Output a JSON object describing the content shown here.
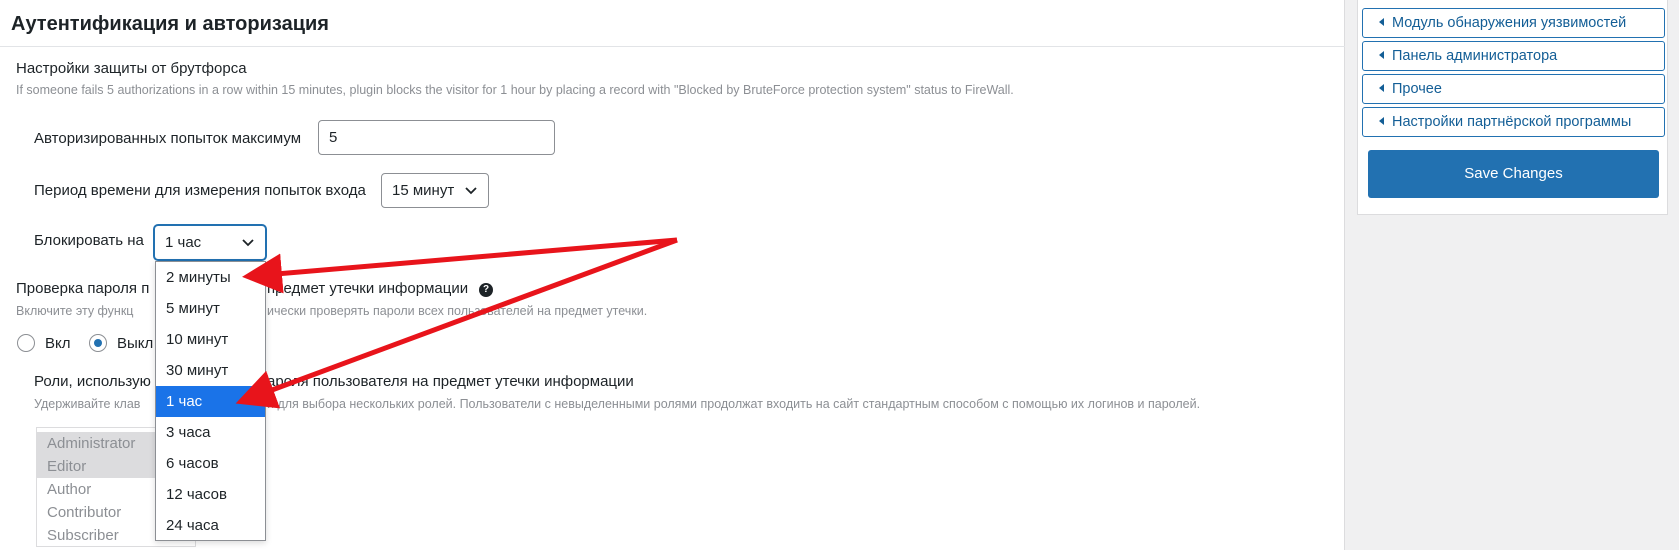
{
  "panel": {
    "title": "Аутентификация и авторизация"
  },
  "bruteforce": {
    "title": "Настройки защиты от брутфорса",
    "description": "If someone fails 5 authorizations in a row within 15 minutes, plugin blocks the visitor for 1 hour by placing a record with \"Blocked by BruteForce protection system\" status to FireWall.",
    "max_attempts_label": "Авторизированных попыток максимум",
    "max_attempts_value": "5",
    "period_label": "Период времени для измерения попыток входа",
    "period_value": "15 минут",
    "block_label": "Блокировать на",
    "block_value": "1 час",
    "block_options": [
      "2 минуты",
      "5 минут",
      "10 минут",
      "30 минут",
      "1 час",
      "3 часа",
      "6 часов",
      "12 часов",
      "24 часа"
    ],
    "block_selected_index": 4
  },
  "leak_check": {
    "title_left": "Проверка пароля п",
    "title_right": "предмет утечки информации",
    "help_glyph": "?",
    "description_left": "Включите эту функц",
    "description_right": "ически проверять пароли всех пользователей на предмет утечки.",
    "option_on": "Вкл",
    "option_off": "Выкл",
    "selected": "off"
  },
  "roles": {
    "title_left": "Роли, использую",
    "title_right": "ароля пользователя на предмет утечки информации",
    "description_left": "Удерживайте клав",
    "description_right": "й для выбора нескольких ролей. Пользователи с невыделенными ролями продолжат входить на сайт стандартным способом с помощью их логинов и паролей.",
    "items": [
      {
        "label": "Administrator",
        "selected": true
      },
      {
        "label": "Editor",
        "selected": true
      },
      {
        "label": "Author",
        "selected": false
      },
      {
        "label": "Contributor",
        "selected": false
      },
      {
        "label": "Subscriber",
        "selected": false
      }
    ]
  },
  "sidebar": {
    "links": [
      "Модуль обнаружения уязвимостей",
      "Панель администратора",
      "Прочее",
      "Настройки партнёрской программы"
    ],
    "save_label": "Save Changes"
  },
  "colors": {
    "accent": "#2271b1",
    "highlight": "#1a73e8",
    "annotation": "#e8141b"
  }
}
